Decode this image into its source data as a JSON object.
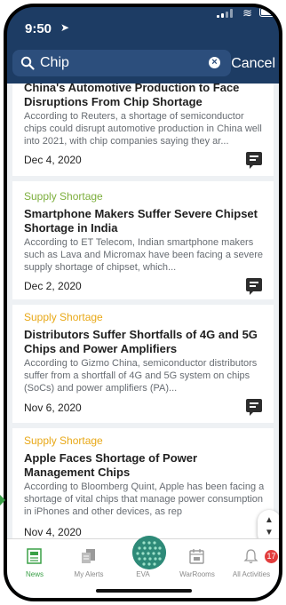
{
  "status_bar": {
    "time": "9:50",
    "location_glyph": "➤",
    "wifi_glyph": "≋"
  },
  "search": {
    "query": "Chip",
    "cancel_label": "Cancel",
    "clear_glyph": "×"
  },
  "articles": [
    {
      "category": "",
      "title": "China's Automotive Production to Face Disruptions From Chip Shortage",
      "summary": "According to Reuters, a shortage of semiconductor chips could disrupt automotive production in China well into 2021, with chip companies saying they ar...",
      "date": "Dec 4, 2020"
    },
    {
      "category": "Supply Shortage",
      "title": "Smartphone Makers Suffer Severe Chipset Shortage in India",
      "summary": "According to ET Telecom, Indian smartphone makers such as Lava and Micromax have been facing a severe supply shortage of chipset, which...",
      "date": "Dec 2, 2020"
    },
    {
      "category": "Supply Shortage",
      "title": "Distributors Suffer Shortfalls of 4G and 5G Chips and Power Amplifiers",
      "summary": "According to Gizmo China, semiconductor distributors suffer from a shortfall of 4G and 5G system on chips (SoCs) and power amplifiers (PA)...",
      "date": "Nov 6, 2020"
    },
    {
      "category": "Supply Shortage",
      "title": "Apple Faces Shortage of Power Management Chips",
      "summary": "According to Bloomberg Quint, Apple has been facing a shortage of vital chips that manage power consumption in iPhones and other devices, as rep",
      "date": "Nov 4, 2020"
    }
  ],
  "colors": {
    "category_green": "#7cae3c",
    "category_yellow": "#e8a817",
    "header_navy": "#1d3c64",
    "active_tab": "#3aa047"
  },
  "tabs": [
    {
      "label": "News",
      "icon": "news-icon"
    },
    {
      "label": "My Alerts",
      "icon": "alerts-icon"
    },
    {
      "label": "EVA",
      "icon": "eva-icon"
    },
    {
      "label": "WarRooms",
      "icon": "warroom-icon"
    },
    {
      "label": "All Activities",
      "icon": "bell-icon"
    }
  ],
  "badge_count": "17",
  "scroll_control": {
    "up": "▲",
    "down": "▼"
  }
}
